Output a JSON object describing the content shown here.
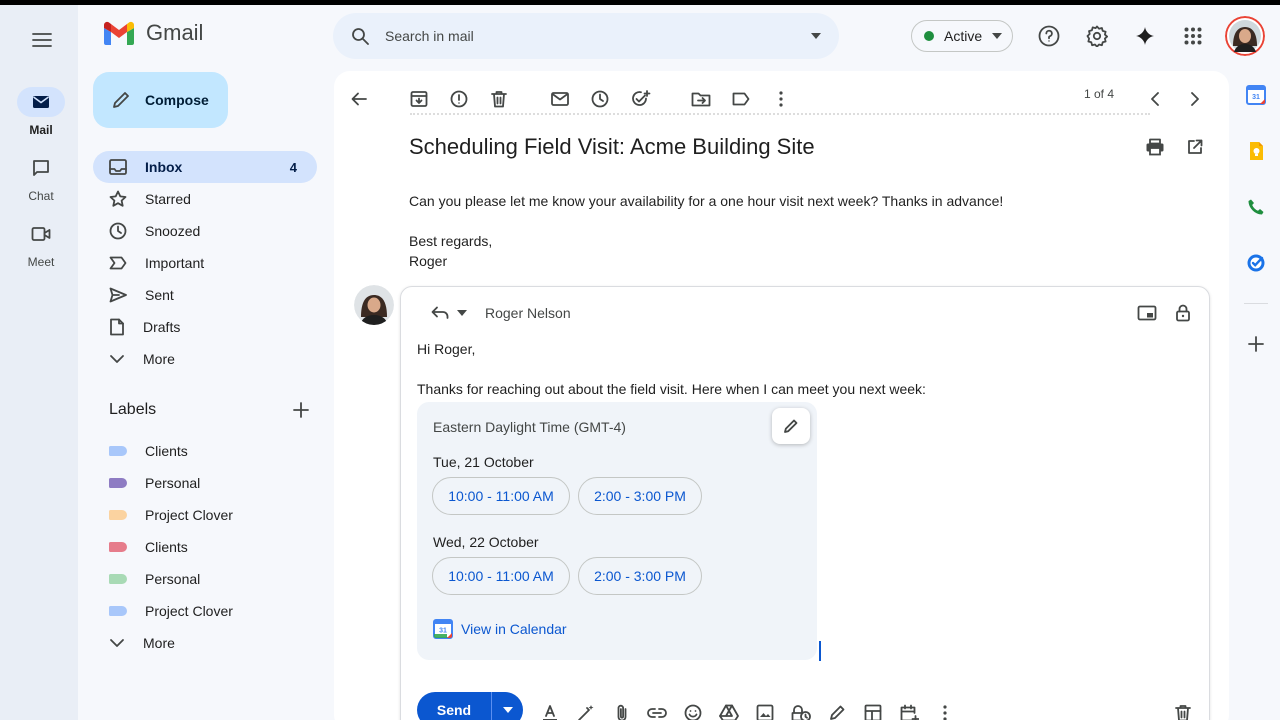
{
  "app": {
    "name": "Gmail"
  },
  "rail": [
    {
      "label": "Mail",
      "icon": "mail-icon",
      "active": true
    },
    {
      "label": "Chat",
      "icon": "chat-icon",
      "active": false
    },
    {
      "label": "Meet",
      "icon": "video-icon",
      "active": false
    }
  ],
  "search": {
    "placeholder": "Search in mail"
  },
  "status": {
    "label": "Active",
    "color": "#1e8e3e"
  },
  "compose": {
    "label": "Compose"
  },
  "nav": [
    {
      "label": "Inbox",
      "count": "4",
      "icon": "inbox-icon",
      "active": true
    },
    {
      "label": "Starred",
      "count": "",
      "icon": "star-icon"
    },
    {
      "label": "Snoozed",
      "count": "",
      "icon": "clock-icon"
    },
    {
      "label": "Important",
      "count": "",
      "icon": "important-icon"
    },
    {
      "label": "Sent",
      "count": "",
      "icon": "send-icon"
    },
    {
      "label": "Drafts",
      "count": "",
      "icon": "draft-icon"
    },
    {
      "label": "More",
      "count": "",
      "icon": "chevron-down-icon"
    }
  ],
  "labels": {
    "heading": "Labels",
    "items": [
      {
        "label": "Clients",
        "color": "#a8c7fa"
      },
      {
        "label": "Personal",
        "color": "#8e7cc3"
      },
      {
        "label": "Project Clover",
        "color": "#fbd3a0"
      },
      {
        "label": "Clients",
        "color": "#e67c8b"
      },
      {
        "label": "Personal",
        "color": "#a8dab5"
      },
      {
        "label": "Project Clover",
        "color": "#a8c7fa"
      },
      {
        "label": "More",
        "color": ""
      }
    ]
  },
  "toolbar": {
    "pager": "1 of 4"
  },
  "email": {
    "subject": "Scheduling Field Visit: Acme Building Site",
    "body": "Can you please let me know your availability for a one hour visit next week? Thanks in advance!",
    "signoff": "Best regards,",
    "signature": "Roger"
  },
  "reply": {
    "to": "Roger Nelson",
    "greeting": "Hi Roger,",
    "intro": "Thanks for reaching out about the field visit. Here when I can meet you next week:",
    "schedule": {
      "timezone": "Eastern Daylight Time (GMT-4)",
      "days": [
        {
          "date": "Tue, 21 October",
          "slots": [
            "10:00 - 11:00 AM",
            "2:00 - 3:00 PM"
          ]
        },
        {
          "date": "Wed, 22 October",
          "slots": [
            "10:00 - 11:00 AM",
            "2:00 - 3:00 PM"
          ]
        }
      ],
      "calendar_link": "View in Calendar",
      "calendar_day": "31"
    },
    "send_label": "Send"
  },
  "colors": {
    "accent": "#0b57d0",
    "compose_bg": "#c2e7ff",
    "nav_active": "#d3e3fd"
  }
}
